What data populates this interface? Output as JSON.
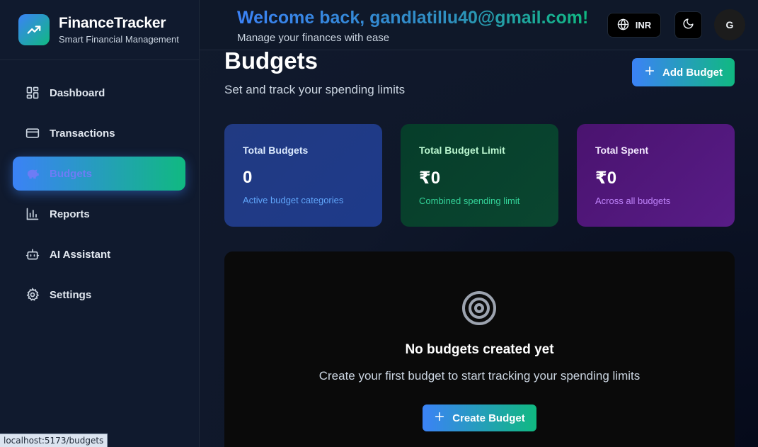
{
  "brand": {
    "name": "FinanceTracker",
    "subtitle": "Smart Financial Management",
    "logo_icon": "trending-up-icon"
  },
  "sidebar": {
    "items": [
      {
        "label": "Dashboard",
        "icon": "dashboard-icon",
        "active": false
      },
      {
        "label": "Transactions",
        "icon": "credit-card-icon",
        "active": false
      },
      {
        "label": "Budgets",
        "icon": "piggy-bank-icon",
        "active": true
      },
      {
        "label": "Reports",
        "icon": "bar-chart-icon",
        "active": false
      },
      {
        "label": "AI Assistant",
        "icon": "bot-icon",
        "active": false
      },
      {
        "label": "Settings",
        "icon": "gear-icon",
        "active": false
      }
    ],
    "active_gradient": [
      "#3b82f6",
      "#10b981"
    ]
  },
  "status_bar": {
    "url": "localhost:5173/budgets"
  },
  "header": {
    "welcome": "Welcome back, gandlatillu40@gmail.com!",
    "subtitle": "Manage your finances with ease",
    "currency_label": "INR",
    "currency_icon": "globe-icon",
    "theme_icon": "moon-icon",
    "avatar_initial": "G"
  },
  "page": {
    "title": "Budgets",
    "subtitle": "Set and track your spending limits",
    "add_button_label": "Add Budget"
  },
  "stats": [
    {
      "label": "Total Budgets",
      "value": "0",
      "note": "Active budget categories",
      "color": "#1e3a8a"
    },
    {
      "label": "Total Budget Limit",
      "value": "₹0",
      "note": "Combined spending limit",
      "color": "#064e3b"
    },
    {
      "label": "Total Spent",
      "value": "₹0",
      "note": "Across all budgets",
      "color": "#581c87"
    }
  ],
  "empty_state": {
    "icon": "target-icon",
    "title": "No budgets created yet",
    "message": "Create your first budget to start tracking your spending limits",
    "button_label": "Create Budget"
  }
}
